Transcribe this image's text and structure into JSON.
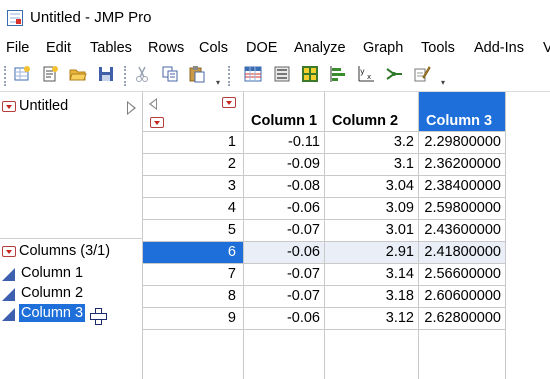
{
  "window": {
    "title": "Untitled - JMP Pro",
    "app_icon": "jmp-table-icon"
  },
  "menu": [
    "File",
    "Edit",
    "Tables",
    "Rows",
    "Cols",
    "DOE",
    "Analyze",
    "Graph",
    "Tools",
    "Add-Ins",
    "V"
  ],
  "toolbar": {
    "icons": [
      "new-data-table-icon",
      "new-script-icon",
      "open-folder-icon",
      "save-icon",
      "cut-icon",
      "copy-icon",
      "paste-icon",
      "data-table-grid-icon",
      "distribution-icon",
      "fit-y-by-x-icon",
      "graph-builder-icon",
      "bar-chart-icon",
      "fit-model-icon",
      "partition-icon",
      "edit-icon"
    ]
  },
  "left_panel": {
    "table_name": "Untitled",
    "columns_label": "Columns (3/1)",
    "columns": [
      {
        "name": "Column 1",
        "selected": false
      },
      {
        "name": "Column 2",
        "selected": false
      },
      {
        "name": "Column 3",
        "selected": true
      }
    ]
  },
  "grid": {
    "headers": [
      "Column 1",
      "Column 2",
      "Column 3"
    ],
    "selected_column": "Column 3",
    "selected_row": "6",
    "rows": [
      {
        "n": "1",
        "c1": "-0.11",
        "c2": "3.2",
        "c3": "2.29800000"
      },
      {
        "n": "2",
        "c1": "-0.09",
        "c2": "3.1",
        "c3": "2.36200000"
      },
      {
        "n": "3",
        "c1": "-0.08",
        "c2": "3.04",
        "c3": "2.38400000"
      },
      {
        "n": "4",
        "c1": "-0.06",
        "c2": "3.09",
        "c3": "2.59800000"
      },
      {
        "n": "5",
        "c1": "-0.07",
        "c2": "3.01",
        "c3": "2.43600000"
      },
      {
        "n": "6",
        "c1": "-0.06",
        "c2": "2.91",
        "c3": "2.41800000"
      },
      {
        "n": "7",
        "c1": "-0.07",
        "c2": "3.14",
        "c3": "2.56600000"
      },
      {
        "n": "8",
        "c1": "-0.07",
        "c2": "3.18",
        "c3": "2.60600000"
      },
      {
        "n": "9",
        "c1": "-0.06",
        "c2": "3.12",
        "c3": "2.62800000"
      }
    ]
  },
  "colors": {
    "selection": "#1e6fd9",
    "column_icon": "#3d5fb0",
    "red_menu": "#c8261f"
  }
}
